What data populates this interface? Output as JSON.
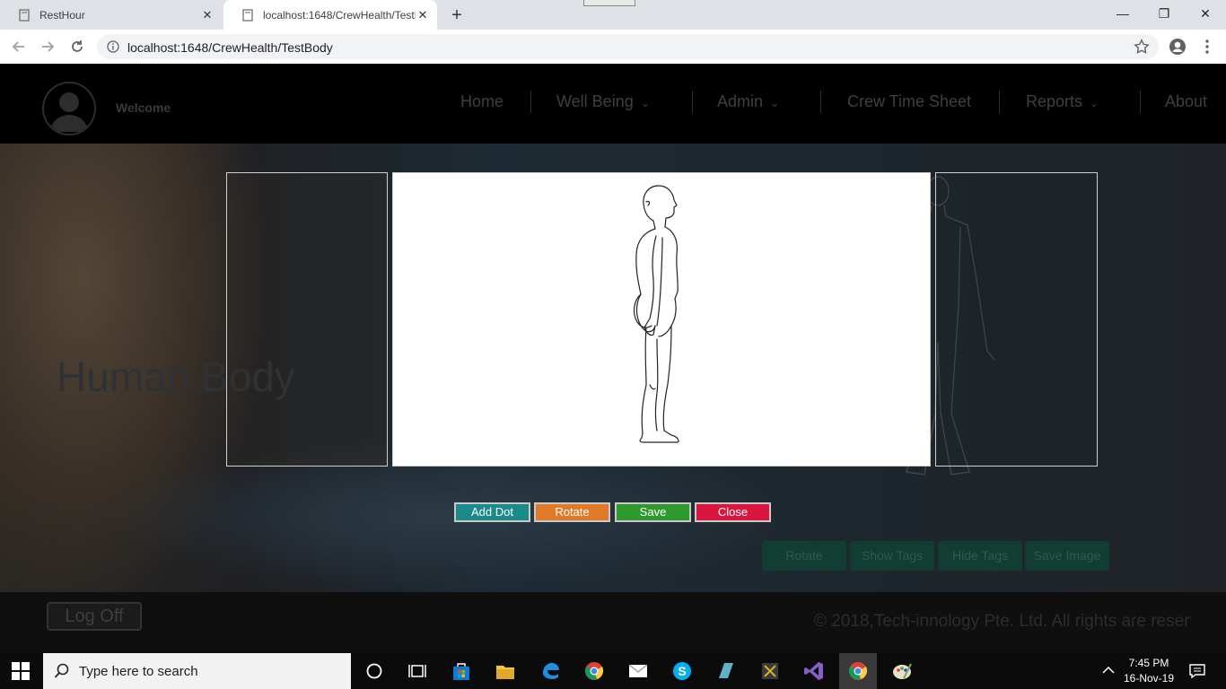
{
  "browser": {
    "tabs": [
      {
        "title": "RestHour",
        "active": false
      },
      {
        "title": "localhost:1648/CrewHealth/TestB",
        "active": true
      }
    ],
    "url": "localhost:1648/CrewHealth/TestBody"
  },
  "navbar": {
    "welcome": "Welcome",
    "items": [
      {
        "label": "Home",
        "dropdown": false
      },
      {
        "label": "Well Being",
        "dropdown": true
      },
      {
        "label": "Admin",
        "dropdown": true
      },
      {
        "label": "Crew Time Sheet",
        "dropdown": false
      },
      {
        "label": "Reports",
        "dropdown": true
      },
      {
        "label": "About",
        "dropdown": false
      }
    ]
  },
  "page": {
    "background_title": "Human Body",
    "background_buttons": [
      "Rotate",
      "Show Tags",
      "Hide Tags",
      "Save Image"
    ]
  },
  "modal": {
    "buttons": [
      {
        "label": "Add Dot",
        "color": "#1a8a8a"
      },
      {
        "label": "Rotate",
        "color": "#e07a28"
      },
      {
        "label": "Save",
        "color": "#2e9a2e"
      },
      {
        "label": "Close",
        "color": "#d9163f"
      }
    ]
  },
  "footer": {
    "logoff": "Log Off",
    "copyright": "© 2018,Tech-innology Pte. Ltd. All rights are reser"
  },
  "taskbar": {
    "search_placeholder": "Type here to search",
    "time": "7:45 PM",
    "date": "16-Nov-19"
  }
}
